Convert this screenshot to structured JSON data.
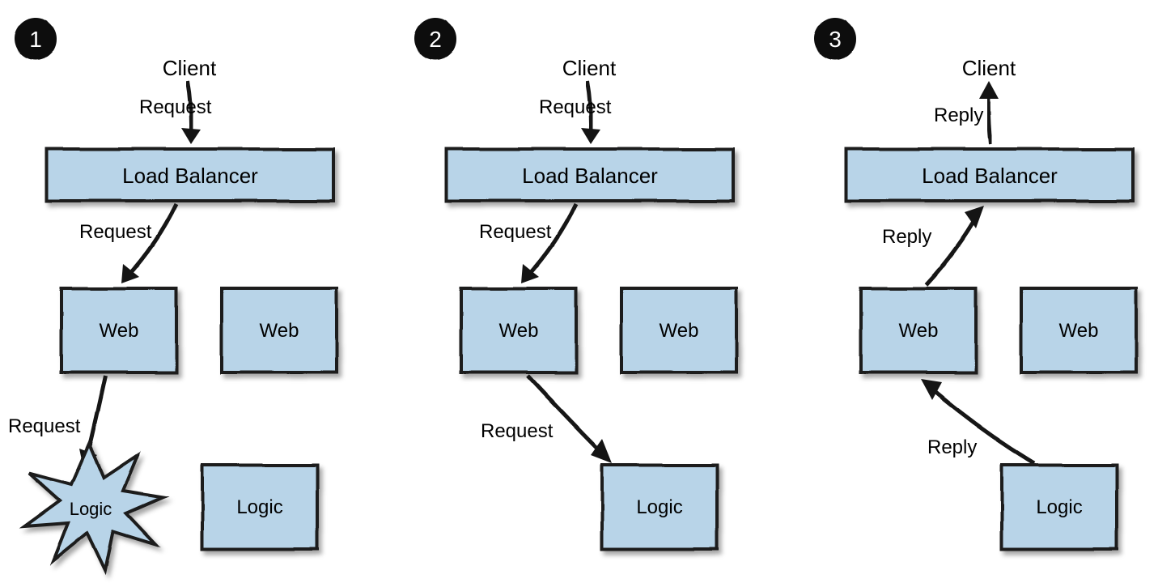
{
  "diagram": {
    "panels": [
      {
        "badge": "1",
        "nodes": {
          "client": "Client",
          "load_balancer": "Load Balancer",
          "web_left": "Web",
          "web_right": "Web",
          "logic_left": "Logic",
          "logic_right": "Logic"
        },
        "edges": [
          {
            "label": "Request",
            "from": "client",
            "to": "load_balancer"
          },
          {
            "label": "Request",
            "from": "load_balancer",
            "to": "web_left"
          },
          {
            "label": "Request",
            "from": "web_left",
            "to": "logic_left"
          }
        ],
        "logic_left_crashed": true
      },
      {
        "badge": "2",
        "nodes": {
          "client": "Client",
          "load_balancer": "Load Balancer",
          "web_left": "Web",
          "web_right": "Web",
          "logic_right": "Logic"
        },
        "edges": [
          {
            "label": "Request",
            "from": "client",
            "to": "load_balancer"
          },
          {
            "label": "Request",
            "from": "load_balancer",
            "to": "web_left"
          },
          {
            "label": "Request",
            "from": "web_left",
            "to": "logic_right"
          }
        ]
      },
      {
        "badge": "3",
        "nodes": {
          "client": "Client",
          "load_balancer": "Load Balancer",
          "web_left": "Web",
          "web_right": "Web",
          "logic_right": "Logic"
        },
        "edges": [
          {
            "label": "Reply",
            "from": "logic_right",
            "to": "web_left"
          },
          {
            "label": "Reply",
            "from": "web_left",
            "to": "load_balancer"
          },
          {
            "label": "Reply",
            "from": "load_balancer",
            "to": "client"
          }
        ]
      }
    ],
    "colors": {
      "box_fill": "#b8d4e8",
      "box_stroke": "#1a1a1a",
      "shadow": "rgba(0,0,0,0.35)",
      "badge_fill": "#0d0d0d",
      "badge_text": "#ffffff"
    }
  }
}
